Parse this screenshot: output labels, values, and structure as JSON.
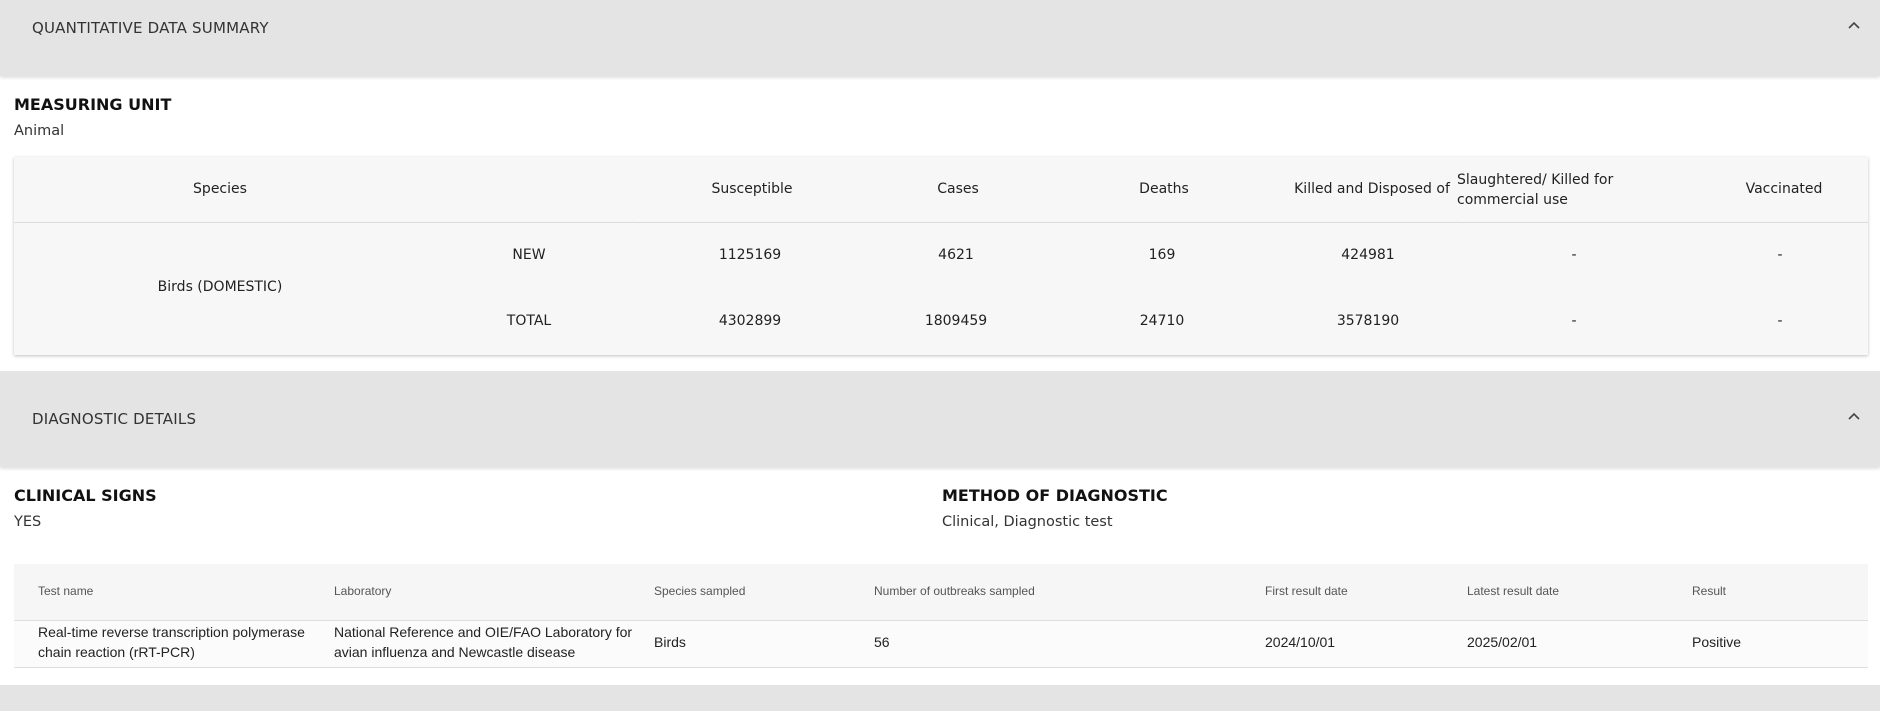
{
  "sections": {
    "quantitative": {
      "title": "QUANTITATIVE DATA SUMMARY"
    },
    "diagnostic": {
      "title": "DIAGNOSTIC DETAILS"
    }
  },
  "measuring_unit": {
    "label": "MEASURING UNIT",
    "value": "Animal"
  },
  "quant_table": {
    "headers": {
      "species": "Species",
      "susceptible": "Susceptible",
      "cases": "Cases",
      "deaths": "Deaths",
      "killed": "Killed and Disposed of",
      "slaughtered": "Slaughtered/ Killed for commercial use",
      "vaccinated": "Vaccinated"
    },
    "species": "Birds (DOMESTIC)",
    "rows": [
      {
        "type": "NEW",
        "susceptible": "1125169",
        "cases": "4621",
        "deaths": "169",
        "killed": "424981",
        "slaughtered": "-",
        "vaccinated": "-"
      },
      {
        "type": "TOTAL",
        "susceptible": "4302899",
        "cases": "1809459",
        "deaths": "24710",
        "killed": "3578190",
        "slaughtered": "-",
        "vaccinated": "-"
      }
    ]
  },
  "clinical_signs": {
    "label": "CLINICAL SIGNS",
    "value": "YES"
  },
  "method_of_diagnostic": {
    "label": "METHOD OF DIAGNOSTIC",
    "value": "Clinical, Diagnostic test"
  },
  "diag_table": {
    "headers": {
      "test_name": "Test name",
      "laboratory": "Laboratory",
      "species_sampled": "Species sampled",
      "outbreaks": "Number of outbreaks sampled",
      "first_date": "First result date",
      "latest_date": "Latest result date",
      "result": "Result"
    },
    "rows": [
      {
        "test_name_l1": "Real-time reverse transcription polymerase",
        "test_name_l2": "chain reaction (rRT-PCR)",
        "laboratory_l1": "National Reference and OIE/FAO Laboratory for",
        "laboratory_l2": "avian influenza and Newcastle disease",
        "species_sampled": "Birds",
        "outbreaks": "56",
        "first_date": "2024/10/01",
        "latest_date": "2025/02/01",
        "result": "Positive"
      }
    ]
  },
  "icons": {
    "collapse": "chevron-up-icon"
  }
}
